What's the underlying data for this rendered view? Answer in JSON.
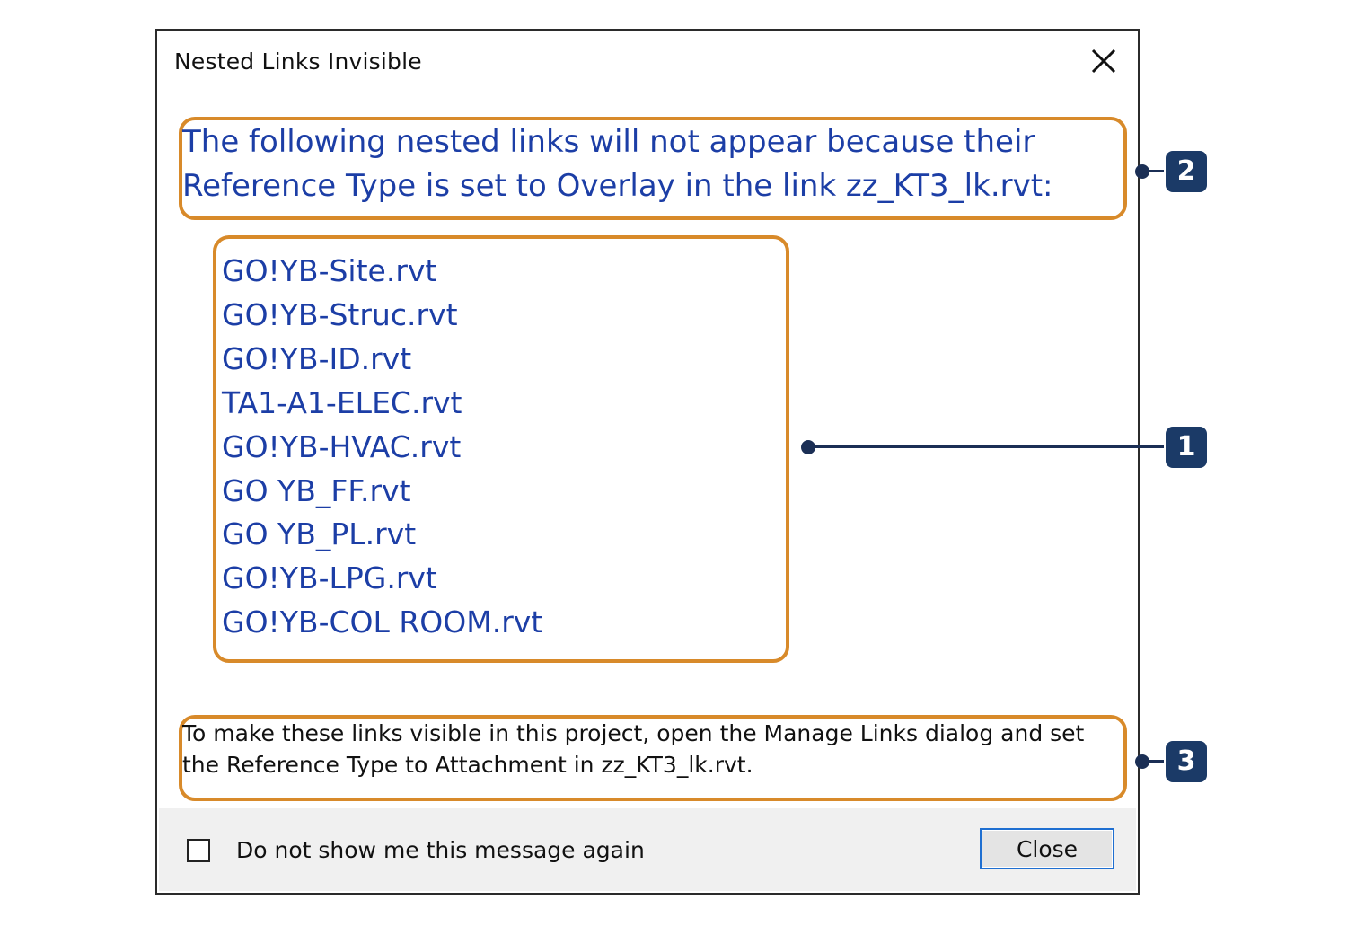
{
  "dialog": {
    "title": "Nested Links Invisible",
    "close_icon": "close-x-icon",
    "message_top": "The following nested links will not appear because their Reference Type is set to Overlay in the link zz_KT3_lk.rvt:",
    "links": [
      "GO!YB-Site.rvt",
      "GO!YB-Struc.rvt",
      "GO!YB-ID.rvt",
      "TA1-A1-ELEC.rvt",
      "GO!YB-HVAC.rvt",
      "GO YB_FF.rvt",
      "GO YB_PL.rvt",
      "GO!YB-LPG.rvt",
      "GO!YB-COL ROOM.rvt"
    ],
    "message_bottom": "To make these links visible in this project, open the Manage Links dialog and set the Reference Type to Attachment in zz_KT3_lk.rvt.",
    "checkbox_label": "Do not show me this message again",
    "checkbox_checked": false,
    "close_button_label": "Close"
  },
  "annotations": {
    "badges": [
      "2",
      "1",
      "3"
    ],
    "badge_color": "#1b3a67",
    "highlight_color": "#d88a2a"
  },
  "colors": {
    "link_text": "#1c3ea6",
    "focus_border": "#1f6fd1"
  }
}
